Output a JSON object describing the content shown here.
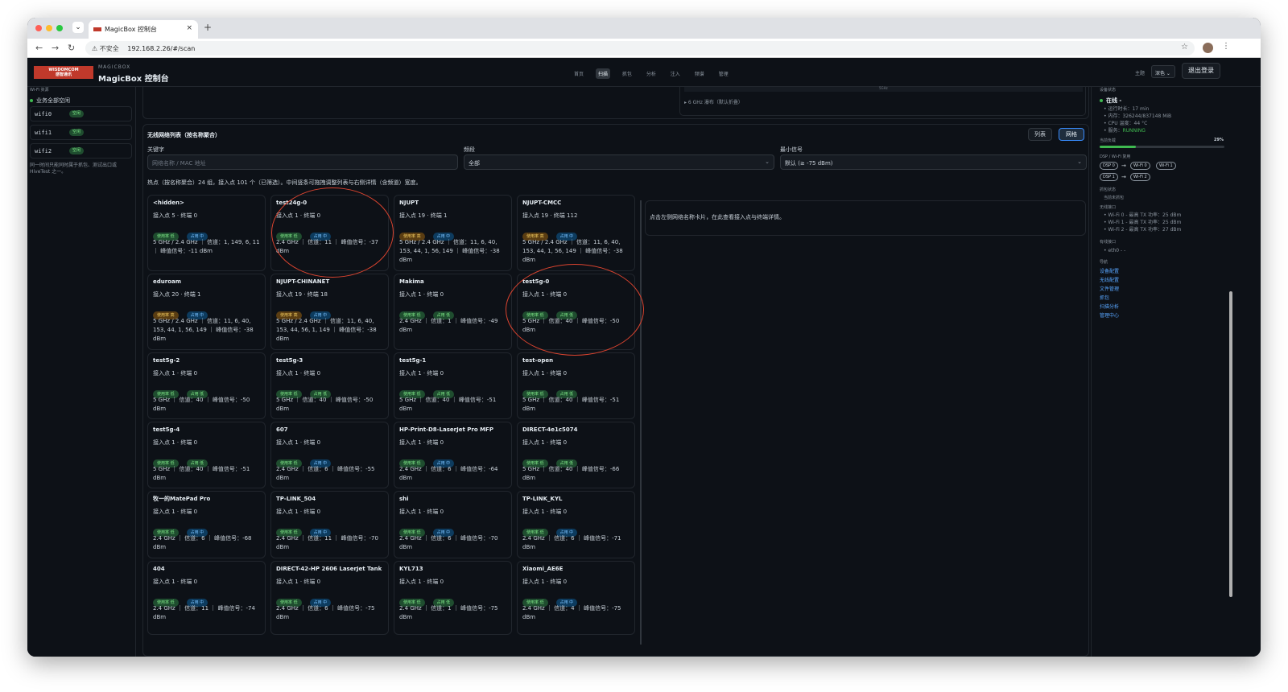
{
  "browser": {
    "tab_title": "MagicBox 控制台",
    "tab_close": "×",
    "new_tab": "+",
    "url_security": "⚠ 不安全",
    "url": "192.168.2.26/#/scan",
    "star": "☆",
    "menu": "⋮",
    "back": "←",
    "forward": "→",
    "reload": "↻",
    "tab_dropdown": "⌄"
  },
  "header": {
    "logo_text": "WISDOMCOM\n感智通讯",
    "brand_small": "MAGICBOX",
    "brand": "MagicBox 控制台",
    "nav": [
      "首页",
      "扫描",
      "抓包",
      "分析",
      "注入",
      "频谱",
      "管理"
    ],
    "nav_active_index": 1,
    "theme_label": "主题",
    "theme_value": "深色",
    "logout": "退出登录"
  },
  "left_sidebar": {
    "caption": "Wi-Fi 资源",
    "status": "业务全部空闲",
    "interfaces": [
      {
        "name": "wifi0",
        "state": "空闲"
      },
      {
        "name": "wifi1",
        "state": "空闲"
      },
      {
        "name": "wifi2",
        "state": "空闲"
      }
    ],
    "note": "同一时间只能同时属于抓包、测试出口或 HiveTest 之一。"
  },
  "top_panel": {
    "bar_text": "5GHz",
    "six_ghz": "▸ 6 GHz 瀑布（默认折叠）"
  },
  "list_panel": {
    "title": "无线网络列表（按名称聚合）",
    "view_list": "列表",
    "view_grid": "网格",
    "filters": {
      "keyword_label": "关键字",
      "keyword_placeholder": "网络名称 / MAC 地址",
      "band_label": "频段",
      "band_value": "全部",
      "signal_label": "最小信号",
      "signal_value": "默认 (≥ -75 dBm)"
    },
    "summary": "热点（按名称聚合）24 组，接入点 101 个（已筛选）。中间竖条可拖拽调整列表与右侧详情（含频道）宽度。",
    "detail_hint": "点击左侧网络名称卡片，在此查看接入点与终端详情。",
    "cards": [
      {
        "ssid": "<hidden>",
        "meta": "接入点 5 · 终端 0",
        "usage": "使用率 低",
        "usage_level": "low",
        "occupy": "占用 中",
        "occupy_level": "mid",
        "rf": "5 GHz / 2.4 GHz ｜ 信道：1, 149, 6, 11 ｜ 峰值信号：-11 dBm"
      },
      {
        "ssid": "test24g-0",
        "meta": "接入点 1 · 终端 0",
        "usage": "使用率 低",
        "usage_level": "low",
        "occupy": "占用 中",
        "occupy_level": "mid",
        "rf": "2.4 GHz ｜ 信道：11 ｜ 峰值信号：-37 dBm"
      },
      {
        "ssid": "NJUPT",
        "meta": "接入点 19 · 终端 1",
        "usage": "使用率 高",
        "usage_level": "high",
        "occupy": "占用 中",
        "occupy_level": "mid",
        "rf": "5 GHz / 2.4 GHz ｜ 信道：11, 6, 40, 153, 44, 1, 56, 149 ｜ 峰值信号：-38 dBm"
      },
      {
        "ssid": "NJUPT-CMCC",
        "meta": "接入点 19 · 终端 112",
        "usage": "使用率 高",
        "usage_level": "high",
        "occupy": "占用 中",
        "occupy_level": "mid",
        "rf": "5 GHz / 2.4 GHz ｜ 信道：11, 6, 40, 153, 44, 1, 56, 149 ｜ 峰值信号：-38 dBm"
      },
      {
        "ssid": "eduroam",
        "meta": "接入点 20 · 终端 1",
        "usage": "使用率 高",
        "usage_level": "high",
        "occupy": "占用 中",
        "occupy_level": "mid",
        "rf": "5 GHz / 2.4 GHz ｜ 信道：11, 6, 40, 153, 44, 1, 56, 149 ｜ 峰值信号：-38 dBm"
      },
      {
        "ssid": "NJUPT-CHINANET",
        "meta": "接入点 19 · 终端 18",
        "usage": "使用率 高",
        "usage_level": "high",
        "occupy": "占用 中",
        "occupy_level": "mid",
        "rf": "5 GHz / 2.4 GHz ｜ 信道：11, 6, 40, 153, 44, 56, 1, 149 ｜ 峰值信号：-38 dBm"
      },
      {
        "ssid": "Makima",
        "meta": "接入点 1 · 终端 0",
        "usage": "使用率 低",
        "usage_level": "low",
        "occupy": "占用 低",
        "occupy_level": "low",
        "rf": "2.4 GHz ｜ 信道：1 ｜ 峰值信号：-49 dBm"
      },
      {
        "ssid": "test5g-0",
        "meta": "接入点 1 · 终端 0",
        "usage": "使用率 低",
        "usage_level": "low",
        "occupy": "占用 低",
        "occupy_level": "low",
        "rf": "5 GHz ｜ 信道：40 ｜ 峰值信号：-50 dBm"
      },
      {
        "ssid": "test5g-2",
        "meta": "接入点 1 · 终端 0",
        "usage": "使用率 低",
        "usage_level": "low",
        "occupy": "占用 低",
        "occupy_level": "low",
        "rf": "5 GHz ｜ 信道：40 ｜ 峰值信号：-50 dBm"
      },
      {
        "ssid": "test5g-3",
        "meta": "接入点 1 · 终端 0",
        "usage": "使用率 低",
        "usage_level": "low",
        "occupy": "占用 低",
        "occupy_level": "low",
        "rf": "5 GHz ｜ 信道：40 ｜ 峰值信号：-50 dBm"
      },
      {
        "ssid": "test5g-1",
        "meta": "接入点 1 · 终端 0",
        "usage": "使用率 低",
        "usage_level": "low",
        "occupy": "占用 低",
        "occupy_level": "low",
        "rf": "5 GHz ｜ 信道：40 ｜ 峰值信号：-51 dBm"
      },
      {
        "ssid": "test-open",
        "meta": "接入点 1 · 终端 0",
        "usage": "使用率 低",
        "usage_level": "low",
        "occupy": "占用 低",
        "occupy_level": "low",
        "rf": "5 GHz ｜ 信道：40 ｜ 峰值信号：-51 dBm"
      },
      {
        "ssid": "test5g-4",
        "meta": "接入点 1 · 终端 0",
        "usage": "使用率 低",
        "usage_level": "low",
        "occupy": "占用 低",
        "occupy_level": "low",
        "rf": "5 GHz ｜ 信道：40 ｜ 峰值信号：-51 dBm"
      },
      {
        "ssid": "607",
        "meta": "接入点 1 · 终端 0",
        "usage": "使用率 低",
        "usage_level": "low",
        "occupy": "占用 中",
        "occupy_level": "mid",
        "rf": "2.4 GHz ｜ 信道：6 ｜ 峰值信号：-55 dBm"
      },
      {
        "ssid": "HP-Print-D8-LaserJet Pro MFP",
        "meta": "接入点 1 · 终端 0",
        "usage": "使用率 低",
        "usage_level": "low",
        "occupy": "占用 中",
        "occupy_level": "mid",
        "rf": "2.4 GHz ｜ 信道：6 ｜ 峰值信号：-64 dBm"
      },
      {
        "ssid": "DIRECT-4e1c5074",
        "meta": "接入点 1 · 终端 0",
        "usage": "使用率 低",
        "usage_level": "low",
        "occupy": "占用 低",
        "occupy_level": "low",
        "rf": "5 GHz ｜ 信道：40 ｜ 峰值信号：-66 dBm"
      },
      {
        "ssid": "牧一的MatePad Pro",
        "meta": "接入点 1 · 终端 0",
        "usage": "使用率 低",
        "usage_level": "low",
        "occupy": "占用 中",
        "occupy_level": "mid",
        "rf": "2.4 GHz ｜ 信道：6 ｜ 峰值信号：-68 dBm"
      },
      {
        "ssid": "TP-LINK_504",
        "meta": "接入点 1 · 终端 0",
        "usage": "使用率 低",
        "usage_level": "low",
        "occupy": "占用 中",
        "occupy_level": "mid",
        "rf": "2.4 GHz ｜ 信道：11 ｜ 峰值信号：-70 dBm"
      },
      {
        "ssid": "shi",
        "meta": "接入点 1 · 终端 0",
        "usage": "使用率 低",
        "usage_level": "low",
        "occupy": "占用 中",
        "occupy_level": "mid",
        "rf": "2.4 GHz ｜ 信道：6 ｜ 峰值信号：-70 dBm"
      },
      {
        "ssid": "TP-LINK_KYL",
        "meta": "接入点 1 · 终端 0",
        "usage": "使用率 低",
        "usage_level": "low",
        "occupy": "占用 中",
        "occupy_level": "mid",
        "rf": "2.4 GHz ｜ 信道：6 ｜ 峰值信号：-71 dBm"
      },
      {
        "ssid": "404",
        "meta": "接入点 1 · 终端 0",
        "usage": "使用率 低",
        "usage_level": "low",
        "occupy": "占用 中",
        "occupy_level": "mid",
        "rf": "2.4 GHz ｜ 信道：11 ｜ 峰值信号：-74 dBm"
      },
      {
        "ssid": "DIRECT-42-HP 2606 LaserJet Tank",
        "meta": "接入点 1 · 终端 0",
        "usage": "使用率 低",
        "usage_level": "low",
        "occupy": "占用 中",
        "occupy_level": "mid",
        "rf": "2.4 GHz ｜ 信道：6 ｜ 峰值信号：-75 dBm"
      },
      {
        "ssid": "KYL713",
        "meta": "接入点 1 · 终端 0",
        "usage": "使用率 低",
        "usage_level": "low",
        "occupy": "占用 低",
        "occupy_level": "low",
        "rf": "2.4 GHz ｜ 信道：1 ｜ 峰值信号：-75 dBm"
      },
      {
        "ssid": "Xiaomi_AE6E",
        "meta": "接入点 1 · 终端 0",
        "usage": "使用率 低",
        "usage_level": "low",
        "occupy": "占用 中",
        "occupy_level": "mid",
        "rf": "2.4 GHz ｜ 信道：4 ｜ 峰值信号：-75 dBm"
      }
    ]
  },
  "right_sidebar": {
    "device_status": "设备状态",
    "online": "在线 -",
    "stats": [
      {
        "label": "运行时长：17 min",
        "highlight": ""
      },
      {
        "label": "内存：326244/837148 MiB",
        "highlight": ""
      },
      {
        "label": "CPU 温度：44 °C",
        "highlight": ""
      },
      {
        "label": "服务：",
        "highlight": "RUNNING"
      }
    ],
    "load_label": "当前负载",
    "load_percent": "29%",
    "load_fraction": 0.29,
    "dsp_label": "DSP / Wi-Fi 复用",
    "dsp_rows": [
      [
        "DSP 0",
        "Wi-Fi 0",
        "Wi-Fi 1"
      ],
      [
        "DSP 1",
        "Wi-Fi 2"
      ]
    ],
    "capture_state_label": "抓包状态",
    "capture_state": "当前未抓包",
    "wireless_label": "无线接口",
    "wireless": [
      "Wi-Fi 0 - 最高 TX 功率：25 dBm",
      "Wi-Fi 1 - 最高 TX 功率：25 dBm",
      "Wi-Fi 2 - 最高 TX 功率：27 dBm"
    ],
    "wired_label": "有线接口",
    "wired": [
      "eth0 - -"
    ],
    "nav_label": "导航",
    "links": [
      "设备配置",
      "无线配置",
      "文件管理",
      "抓包",
      "扫描分析",
      "管理中心"
    ]
  }
}
